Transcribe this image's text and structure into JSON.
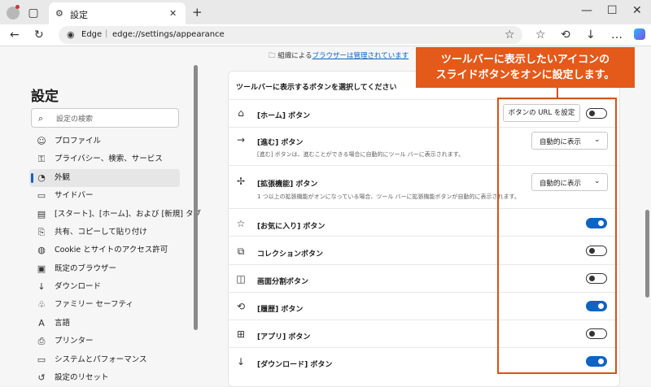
{
  "tab": {
    "title": "設定"
  },
  "address": {
    "brand": "Edge",
    "url": "edge://settings/appearance"
  },
  "banner": {
    "prefix": "組織による",
    "link": "ブラウザーは管理されています"
  },
  "sidebar": {
    "title": "設定",
    "search_placeholder": "設定の検索",
    "items": [
      {
        "label": "プロファイル",
        "icon": "person-icon"
      },
      {
        "label": "プライバシー、検索、サービス",
        "icon": "lock-icon"
      },
      {
        "label": "外観",
        "icon": "palette-icon"
      },
      {
        "label": "サイドバー",
        "icon": "sidebar-icon"
      },
      {
        "label": "[スタート]、[ホーム]、および [新規] タブ",
        "icon": "home-tab-icon"
      },
      {
        "label": "共有、コピーして貼り付け",
        "icon": "share-icon"
      },
      {
        "label": "Cookie とサイトのアクセス許可",
        "icon": "cookie-icon"
      },
      {
        "label": "既定のブラウザー",
        "icon": "browser-icon"
      },
      {
        "label": "ダウンロード",
        "icon": "download-icon"
      },
      {
        "label": "ファミリー セーフティ",
        "icon": "family-icon"
      },
      {
        "label": "言語",
        "icon": "language-icon"
      },
      {
        "label": "プリンター",
        "icon": "printer-icon"
      },
      {
        "label": "システムとパフォーマンス",
        "icon": "system-icon"
      },
      {
        "label": "設定のリセット",
        "icon": "reset-icon"
      }
    ]
  },
  "main": {
    "heading": "ツールバーに表示するボタンを選択してください",
    "rows": [
      {
        "label": "[ホーム] ボタン",
        "icon": "home-icon",
        "button": "ボタンの URL を設定",
        "toggle": false
      },
      {
        "label": "[進む] ボタン",
        "icon": "forward-icon",
        "desc": "[進む] ボタンは、進むことができる場合に自動的にツール バーに表示されます。",
        "select": "自動的に表示"
      },
      {
        "label": "[拡張機能] ボタン",
        "icon": "puzzle-icon",
        "desc": "1 つ以上の拡張機能がオンになっている場合、ツール バーに拡張機能ボタンが自動的に表示されます。",
        "select": "自動的に表示"
      },
      {
        "label": "[お気に入り] ボタン",
        "icon": "favorites-icon",
        "toggle": true
      },
      {
        "label": "コレクションボタン",
        "icon": "collections-icon",
        "toggle": false
      },
      {
        "label": "画面分割ボタン",
        "icon": "split-screen-icon",
        "toggle": false
      },
      {
        "label": "[履歴] ボタン",
        "icon": "history-icon",
        "toggle": true
      },
      {
        "label": "[アプリ] ボタン",
        "icon": "apps-icon",
        "toggle": false
      },
      {
        "label": "[ダウンロード] ボタン",
        "icon": "download-icon",
        "toggle": true
      }
    ]
  },
  "callout": {
    "line1": "ツールバーに表示したいアイコンの",
    "line2": "スライドボタンをオンに設定します。"
  },
  "colors": {
    "accent": "#0f63c2",
    "callout": "#e35a1a"
  }
}
